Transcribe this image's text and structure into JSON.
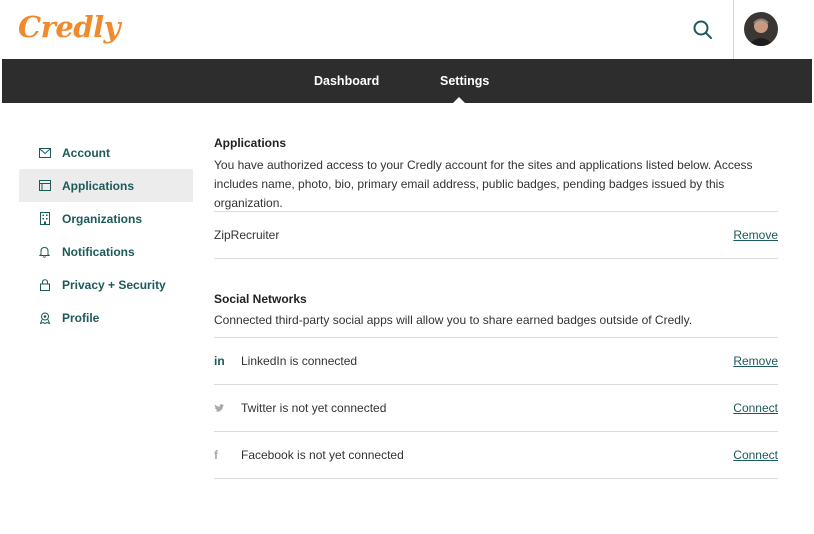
{
  "brand": {
    "logo_text": "Credly",
    "accent": "#f18a2c",
    "link_color": "#1c5a59"
  },
  "header": {
    "search_icon": "search-icon",
    "avatar_alt": "user-avatar"
  },
  "nav": {
    "items": [
      {
        "label": "Dashboard"
      },
      {
        "label": "Settings",
        "active": true
      }
    ]
  },
  "sidebar": {
    "items": [
      {
        "label": "Account",
        "icon": "envelope-icon"
      },
      {
        "label": "Applications",
        "icon": "browser-window-icon",
        "active": true
      },
      {
        "label": "Organizations",
        "icon": "building-icon"
      },
      {
        "label": "Notifications",
        "icon": "bell-icon"
      },
      {
        "label": "Privacy + Security",
        "icon": "lock-icon"
      },
      {
        "label": "Profile",
        "icon": "person-badge-icon"
      }
    ]
  },
  "applications": {
    "title": "Applications",
    "description": "You have authorized access to your Credly account for the sites and applications listed below. Access includes name, photo, bio, primary email address, public badges, pending badges issued by this organization.",
    "items": [
      {
        "name": "ZipRecruiter",
        "action": "Remove"
      }
    ]
  },
  "social": {
    "title": "Social Networks",
    "description": "Connected third-party social apps will allow you to share earned badges outside of Credly.",
    "items": [
      {
        "icon": "linkedin-icon",
        "icon_text": "in",
        "label": "LinkedIn is connected",
        "action": "Remove"
      },
      {
        "icon": "twitter-icon",
        "label": "Twitter is not yet connected",
        "action": "Connect"
      },
      {
        "icon": "facebook-icon",
        "icon_text": "f",
        "label": "Facebook is not yet connected",
        "action": "Connect"
      }
    ]
  }
}
